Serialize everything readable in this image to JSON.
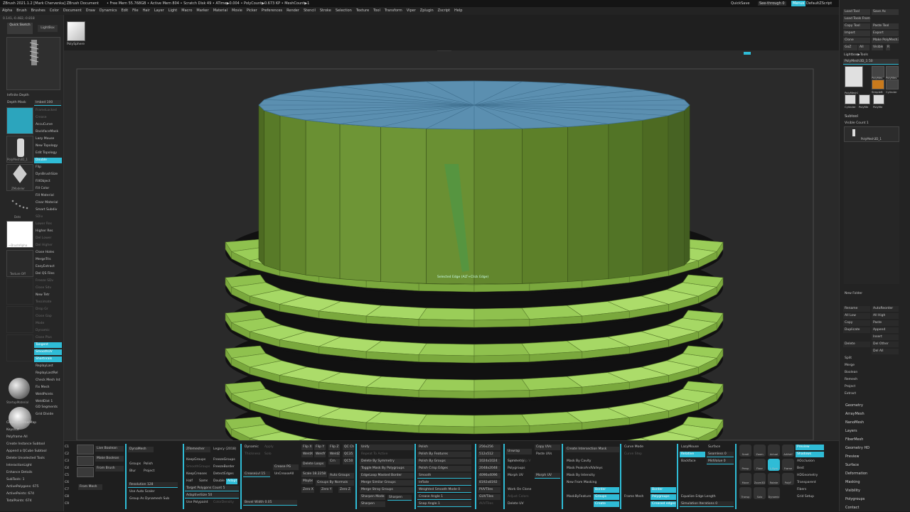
{
  "titlebar": {
    "title": "ZBrush 2021.1.2 [Mark Chervenka]   ZBrush Document",
    "stats": "• Free Mem 55.768GB • Active Mem 804 • Scratch Disk 49 • ATime▶0.004 • PolyCount▶0.673 KP • MeshCount▶1",
    "quicksave": "QuickSave",
    "see_through": "See-through  0",
    "menus": "Menus",
    "zscript": "DefaultZScript"
  },
  "menubar": [
    "Alpha",
    "Brush",
    "Brushes",
    "Color",
    "Document",
    "Draw",
    "Dynamics",
    "Edit",
    "File",
    "Hair",
    "Layer",
    "Light",
    "Macro",
    "Marker",
    "Material",
    "Movie",
    "Picker",
    "Preferences",
    "Render",
    "Stencil",
    "Stroke",
    "Selection",
    "Texture",
    "Tool",
    "Transform",
    "Viper",
    "Zplugin",
    "Zscript",
    "Help"
  ],
  "coords": "0.141,-0.482,-0.818",
  "topshelf": {
    "quick_sketch": "Quick Sketch",
    "lightbox": "LightBox",
    "polysphere": "PolySphere"
  },
  "left": {
    "infinite_depth": "Infinite Depth",
    "depth_mask": "Depth Mask",
    "imbed": "Imbed 100",
    "buttons": [
      {
        "label": "FrameLocked",
        "state": "dim"
      },
      {
        "label": "Crease",
        "state": "dim"
      },
      {
        "label": "AccuCurve",
        "state": ""
      },
      {
        "label": "BackfaceMask",
        "state": ""
      },
      {
        "label": "Lazy Mouse",
        "state": ""
      },
      {
        "label": "New Topology",
        "state": ""
      },
      {
        "label": "Edit Topology",
        "state": ""
      },
      {
        "label": "Double",
        "state": "on"
      },
      {
        "label": "Flip",
        "state": ""
      },
      {
        "label": "DynBrushSize",
        "state": ""
      },
      {
        "label": "FillObject",
        "state": ""
      },
      {
        "label": "Fill Color",
        "state": ""
      },
      {
        "label": "Fill Material",
        "state": ""
      },
      {
        "label": "Clear Material",
        "state": ""
      },
      {
        "label": "Smart Subdiv",
        "state": ""
      },
      {
        "label": "SDiv",
        "state": "dim"
      },
      {
        "label": "Lower Res",
        "state": "dim"
      },
      {
        "label": "Higher Res",
        "state": ""
      },
      {
        "label": "Del Lower",
        "state": "dim"
      },
      {
        "label": "Del Higher",
        "state": "dim"
      },
      {
        "label": "Close Holes",
        "state": ""
      },
      {
        "label": "MergeTris",
        "state": ""
      },
      {
        "label": "EasyExtract",
        "state": ""
      },
      {
        "label": "Del QS Files",
        "state": ""
      },
      {
        "label": "Freeze SDv",
        "state": "dim"
      },
      {
        "label": "Close Sdv",
        "state": "dim"
      },
      {
        "label": "New Tetr",
        "state": ""
      },
      {
        "label": "Tessimate",
        "state": "dim"
      },
      {
        "label": "Drop Gr",
        "state": "dim"
      },
      {
        "label": "Close Gap",
        "state": "dim"
      },
      {
        "label": "Mode",
        "state": "dim"
      },
      {
        "label": "Dynamic",
        "state": "dim"
      },
      {
        "label": "Close Plus",
        "state": "dim"
      },
      {
        "label": "Tangent",
        "state": "on"
      },
      {
        "label": "SmoothUV",
        "state": "on"
      },
      {
        "label": "Shortnrals",
        "state": "on"
      },
      {
        "label": "ReplayLast",
        "state": ""
      },
      {
        "label": "ReplayLastRel",
        "state": ""
      },
      {
        "label": "Check Mesh Int",
        "state": ""
      },
      {
        "label": "Fix Mesh",
        "state": ""
      },
      {
        "label": "WeldPoints",
        "state": ""
      },
      {
        "label": "WeldDist 1",
        "state": ""
      },
      {
        "label": "GD Segments",
        "state": ""
      },
      {
        "label": "Grid Divide",
        "state": ""
      }
    ],
    "thumb_labels": {
      "polymesh": "PolyMesh3D_1",
      "zmodeler": "ZModeler",
      "dots": "Dots",
      "brushalpha": "~BrushAlpha",
      "texture": "Texture Off",
      "material": "StartupMaterial"
    },
    "lower": [
      "Create NormalMap",
      "Keyshot",
      "Polyframe All",
      "Create Instance Subtool",
      "Append a QCube Subtool",
      "Delete Unselected Tools",
      "InteractionLight",
      "Enhance Details",
      "SubTools: 1",
      "ActivePolygons: 675",
      "ActivePoints: 674",
      "TotalPoints: 674"
    ]
  },
  "viewport": {
    "annotation": "Selected Edge (ALT+Click Edge)"
  },
  "right": {
    "top_buttons": [
      [
        "Load Tool",
        "Save As"
      ],
      [
        "Load Tools From Project",
        ""
      ],
      [
        "Copy Tool",
        "Paste Tool"
      ],
      [
        "Import",
        "Export"
      ],
      [
        "Clone",
        "Make PolyMesh3D"
      ],
      [
        "GoZ",
        "All",
        "Visible",
        "R"
      ]
    ],
    "lightbox_tools": "Lightbox▶Tools",
    "current_tool": "PolyMesh3D_1  50",
    "tool_thumbs": [
      "PolyMesh3D_1",
      "PolyMes",
      "PolyMes",
      "SimpleB",
      "Cylinder",
      "Cylinder",
      "PolyMe",
      "PolyMe"
    ],
    "subtool": "Subtool",
    "visible_count": "Visible Count  1",
    "subtool_item": "PolyMesh3D_1",
    "new_folder": "New Folder",
    "lower_buttons": [
      [
        "Rename",
        "AutoReorder"
      ],
      [
        "All Low",
        "All High"
      ],
      [
        "Copy",
        "Paste"
      ],
      [
        "Duplicate",
        "Append"
      ],
      [
        "",
        "Insert"
      ],
      [
        "Delete",
        "Del Other"
      ],
      [
        "",
        "Del All"
      ]
    ],
    "list_items": [
      "Split",
      "Merge",
      "Boolean",
      "Remesh",
      "Project",
      "Extract"
    ],
    "sections": [
      "Geometry",
      "ArrayMesh",
      "NanoMesh",
      "Layers",
      "FiberMesh",
      "Geometry HD",
      "Preview",
      "Surface",
      "Deformation",
      "Masking",
      "Visibility",
      "Polygroups",
      "Contact"
    ]
  },
  "bottom": {
    "col1": [
      "Live Boolean",
      "Make Boolean",
      "From Brush",
      "From Mesh"
    ],
    "col_dyna": [
      "DynaMesh",
      "Groups",
      "Polish",
      "Blur",
      "Project",
      "Resolution 128",
      "Use Auto Scaler",
      "Group As Dynamesh Sub"
    ],
    "col_zrem": [
      "ZRemesher",
      "Legacy (2018)",
      "KeepGroups",
      "FreezeGroups",
      "SmoothGroups",
      "FreezeBorder",
      "KeepCreases",
      "DetectEdges",
      "Half",
      "Same",
      "Double",
      "Adapt",
      "Target Polygons Count 5",
      "AdaptiveSize 50",
      "Use Polypaint",
      "ColorDensity"
    ],
    "col_dyn": [
      "Dynamic",
      "Thickness",
      "Apply",
      "Solo",
      "Crease PG",
      "CreaseLvl 15",
      "UnCreaseAll",
      "Bevel Width 0.05"
    ],
    "col_flip": [
      "Flip X",
      "Flip Y",
      "Flip Z",
      "QC Ch",
      "WeldX",
      "WeldY",
      "WeldZ",
      "QC35",
      "Delete Loops",
      "Crn",
      "QC50",
      "Scale 18.2258",
      "Auto Groups",
      "Maybe",
      "Groups By Normals",
      "Zero X",
      "Zero Y",
      "Zero Z"
    ],
    "col_poly": [
      "Unify",
      "Repeat To Active",
      "Delete By Symmetry",
      "Toggle Mask By Polygroups",
      "EdgeLoop Masked Border",
      "Merge Similar Groups",
      "Merge Stray Groups",
      "Sharpen Mode",
      "Sharpen"
    ],
    "col_polish": [
      "Polish",
      "Polish By Features",
      "Polish By Groups",
      "Polish Crisp Edges",
      "Smooth",
      "Inflate",
      "Weighted Smooth Mode 0",
      "Crease Angle 1",
      "Snap Angle 1"
    ],
    "col_tex": [
      "256x256",
      "512x512",
      "1024x1024",
      "2048x2048",
      "4096x4096",
      "8192x8192",
      "PUVTiles",
      "GUVTiles",
      "AUVTiles"
    ],
    "col_uv": [
      "Copy UVs",
      "Paste UVs",
      "Unwrap",
      "Flip U",
      "Flip V",
      "Symmetry",
      "Polygroups",
      "Morph UV",
      "Morph UV",
      "Work On Clone",
      "Adjust Colors",
      "Delete UV"
    ],
    "col_mask": [
      "Create Intersection Mask",
      "Mask By Cavity",
      "Mask PeaksAndValleys",
      "Mask By Intensity",
      "New From Masking",
      "MaskByFeature",
      "Groups",
      "Border",
      "Create"
    ],
    "col_curve": [
      "Curve Mode",
      "Curve Step",
      "Frame Mesh",
      "Polygroups",
      "Border",
      "Creased edges"
    ],
    "col_preview": [
      "Preview",
      "Shadows",
      "AOcclusion",
      "Best",
      "HDGeometry",
      "Transparent",
      "Fibers",
      "Grid Setup"
    ],
    "col_lazy": [
      "LazyMouse",
      "LazyStep",
      "Surface",
      "Seamless 0",
      "Relative",
      "Backface",
      "MidValue 0",
      "Equalize Edge Length",
      "Simulation Iterations 0"
    ],
    "nav": [
      "Scroll",
      "Zoom",
      "Actual",
      "AAHalf",
      "Persp",
      "Floor",
      "L.Sym",
      "Frame",
      "Move",
      "Zoom3D",
      "Rotate",
      "PolyF",
      "Transp",
      "Solo",
      "Dynamic"
    ],
    "side_labels": [
      "C1",
      "C2",
      "C3",
      "C4",
      "C5",
      "C6",
      "C7",
      "C8",
      "C9"
    ]
  }
}
